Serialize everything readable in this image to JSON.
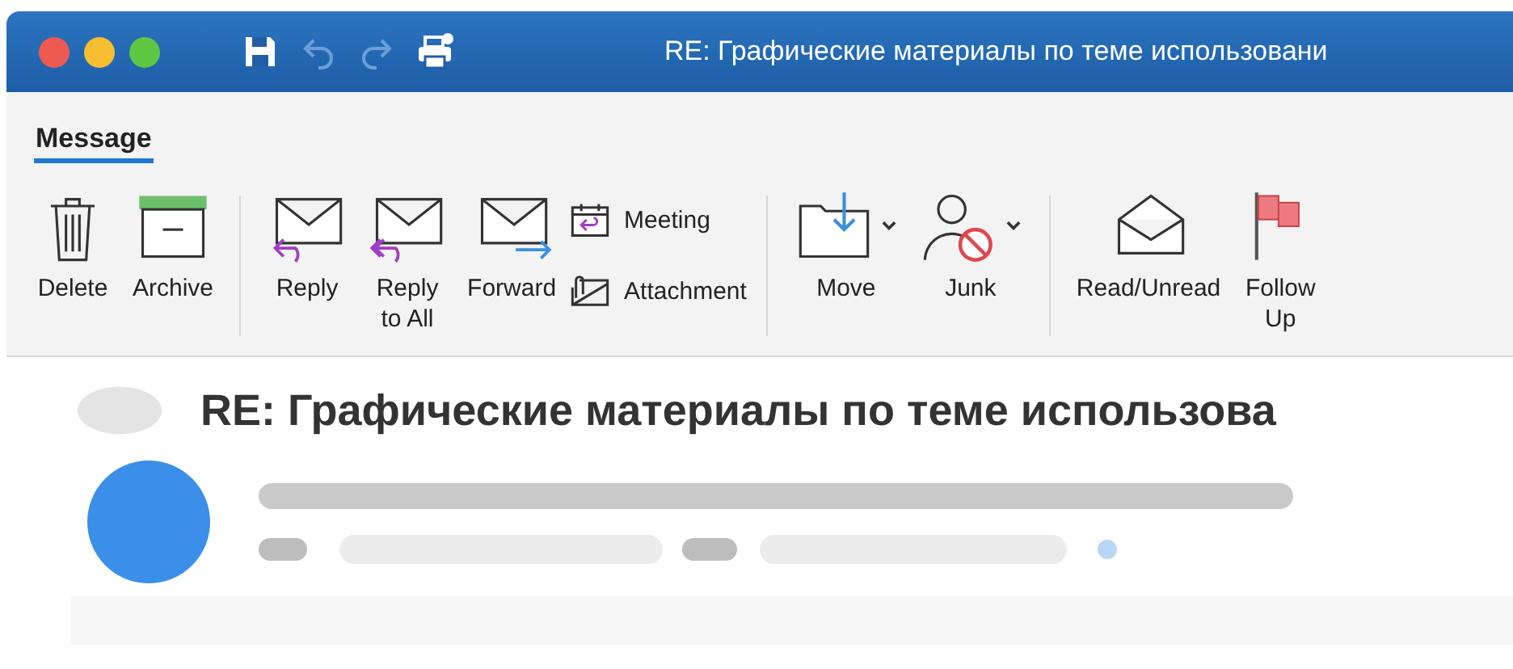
{
  "window": {
    "title": "RE: Графические материалы по теме использовани"
  },
  "quick_access": [
    {
      "kind": "save",
      "disabled": false
    },
    {
      "kind": "undo",
      "disabled": true
    },
    {
      "kind": "redo",
      "disabled": true
    },
    {
      "kind": "print",
      "disabled": false
    }
  ],
  "tabs": [
    {
      "label": "Message",
      "selected": true
    }
  ],
  "ribbon": [
    {
      "buttons": [
        {
          "kind": "delete",
          "label": "Delete"
        },
        {
          "kind": "archive",
          "label": "Archive"
        }
      ]
    },
    {
      "buttons": [
        {
          "kind": "reply",
          "label": "Reply"
        },
        {
          "kind": "reply_all",
          "label": "Reply\nto All"
        },
        {
          "kind": "forward",
          "label": "Forward"
        }
      ],
      "small_buttons": [
        {
          "kind": "meeting",
          "label": "Meeting"
        },
        {
          "kind": "attachment",
          "label": "Attachment"
        }
      ]
    },
    {
      "buttons": [
        {
          "kind": "move",
          "label": "Move",
          "dropdown": true
        },
        {
          "kind": "junk",
          "label": "Junk",
          "dropdown": true
        }
      ]
    },
    {
      "buttons": [
        {
          "kind": "read_unread",
          "label": "Read/Unread"
        },
        {
          "kind": "follow_up",
          "label": "Follow\nUp"
        }
      ]
    }
  ],
  "message": {
    "subject": "RE: Графические материалы по теме использова"
  }
}
